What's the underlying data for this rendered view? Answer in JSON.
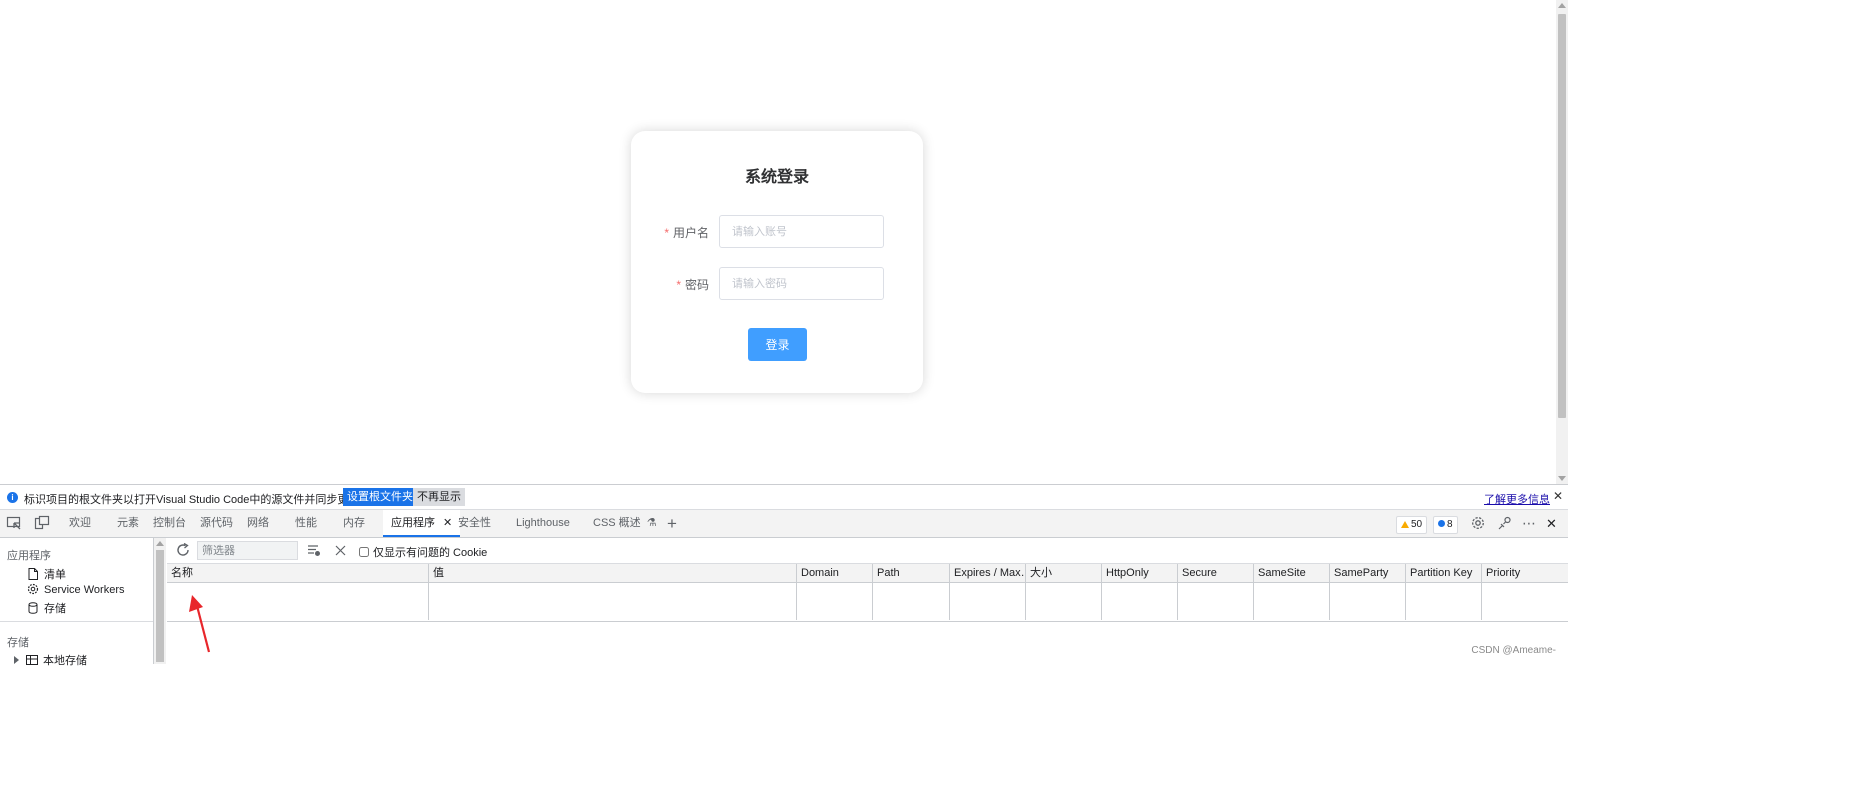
{
  "login": {
    "title": "系统登录",
    "username": {
      "required_mark": "*",
      "label": "用户名",
      "placeholder": "请输入账号"
    },
    "password": {
      "required_mark": "*",
      "label": "密码",
      "placeholder": "请输入密码"
    },
    "submit_label": "登录",
    "accent_color": "#409eff"
  },
  "devtools": {
    "infobar": {
      "message": "标识项目的根文件夹以打开Visual Studio Code中的源文件并同步更改。",
      "primary_button": "设置根文件夹",
      "secondary_button": "不再显示",
      "learn_more": "了解更多信息",
      "close": "✕"
    },
    "tabs": [
      {
        "label": "欢迎"
      },
      {
        "label": "元素"
      },
      {
        "label": "控制台"
      },
      {
        "label": "源代码"
      },
      {
        "label": "网络"
      },
      {
        "label": "性能"
      },
      {
        "label": "内存"
      },
      {
        "label": "应用程序",
        "active": true
      },
      {
        "label": "安全性"
      },
      {
        "label": "Lighthouse"
      },
      {
        "label": "CSS 概述"
      }
    ],
    "warnings_count": "50",
    "messages_count": "8",
    "sidebar": {
      "app_section": "应用程序",
      "items": [
        {
          "label": "清单",
          "icon": "document-icon"
        },
        {
          "label": "Service Workers",
          "icon": "gear-icon"
        },
        {
          "label": "存储",
          "icon": "database-icon"
        }
      ],
      "storage_section": "存储",
      "storage_items": [
        {
          "label": "本地存储",
          "icon": "grid-icon"
        }
      ]
    },
    "toolbar": {
      "filter_placeholder": "筛选器",
      "only_issues_label": "仅显示有问题的 Cookie"
    },
    "cookie_table": {
      "columns": [
        "名称",
        "值",
        "Domain",
        "Path",
        "Expires / Max…",
        "大小",
        "HttpOnly",
        "Secure",
        "SameSite",
        "SameParty",
        "Partition Key",
        "Priority"
      ],
      "rows": []
    }
  },
  "watermark": "CSDN @Ameame-"
}
